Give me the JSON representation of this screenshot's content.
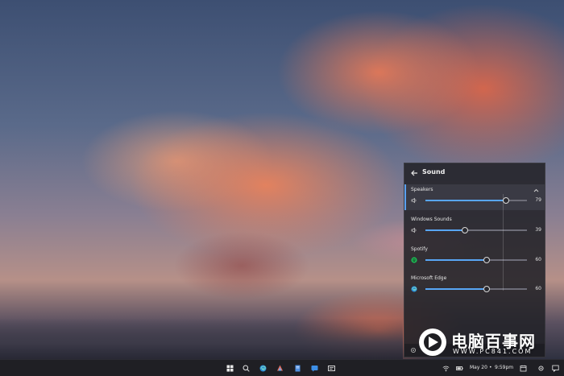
{
  "flyout": {
    "title": "Sound",
    "rows": [
      {
        "label": "Speakers",
        "value": "79",
        "level": 79,
        "icon": "speaker-icon"
      },
      {
        "label": "Windows Sounds",
        "value": "39",
        "level": 39,
        "icon": "speaker-icon"
      },
      {
        "label": "Spotify",
        "value": "60",
        "level": 60,
        "icon": "spotify-icon"
      },
      {
        "label": "Microsoft Edge",
        "value": "60",
        "level": 60,
        "icon": "edge-icon"
      }
    ]
  },
  "taskbar": {
    "date": "May 20",
    "separator": "•",
    "time": "9:59pm",
    "apps": [
      "start-icon",
      "search-icon",
      "edge-icon",
      "photos-icon",
      "files-icon",
      "store-icon",
      "mail-icon"
    ]
  },
  "watermark": {
    "title": "电脑百事网",
    "url": "WWW.PC841.COM"
  },
  "colors": {
    "accent": "#58a6f5",
    "flyout_bg": "#222228",
    "taskbar_bg": "#1f1f24"
  }
}
